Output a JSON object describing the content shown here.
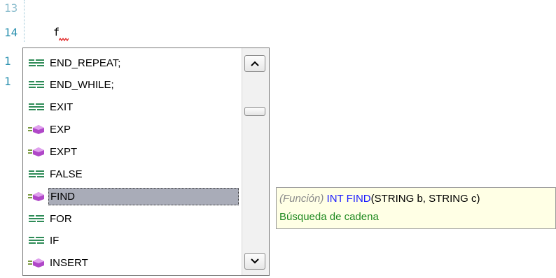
{
  "editor": {
    "line_numbers": [
      "13",
      "14",
      "1",
      "1"
    ],
    "current_code": "f"
  },
  "completion": {
    "items": [
      {
        "label": "END_REPEAT;",
        "icon": "keyword-icon"
      },
      {
        "label": "END_WHILE;",
        "icon": "keyword-icon"
      },
      {
        "label": "EXIT",
        "icon": "keyword-icon"
      },
      {
        "label": "EXP",
        "icon": "function-icon"
      },
      {
        "label": "EXPT",
        "icon": "function-icon"
      },
      {
        "label": "FALSE",
        "icon": "keyword-icon"
      },
      {
        "label": "FIND",
        "icon": "function-icon",
        "selected": true
      },
      {
        "label": "FOR",
        "icon": "keyword-icon"
      },
      {
        "label": "IF",
        "icon": "keyword-icon"
      },
      {
        "label": "INSERT",
        "icon": "function-icon"
      }
    ]
  },
  "tooltip": {
    "kind": "(Función)",
    "return_type": "INT",
    "function_name": "FIND",
    "params": "(STRING b, STRING c)",
    "description": "Búsqueda de cadena"
  },
  "colors": {
    "keyword_icon": "#2e8b57",
    "function_icon": "#b048c8",
    "selection": "#a9acb8"
  }
}
